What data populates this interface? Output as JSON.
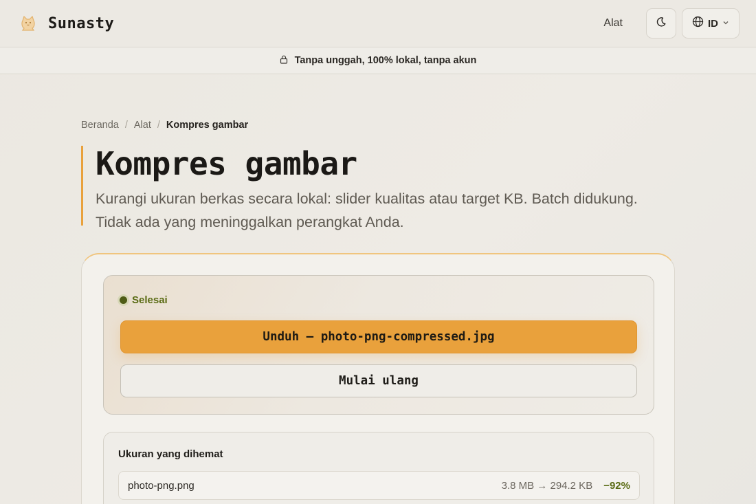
{
  "header": {
    "brand": "Sunasty",
    "nav_tools": "Alat",
    "language": "ID",
    "icons": {
      "logo": "cat-logo-icon",
      "theme": "moon-icon",
      "language": "globe-icon",
      "dropdown": "chevron-down-icon"
    }
  },
  "banner": {
    "text": "Tanpa unggah, 100% lokal, tanpa akun",
    "icon": "lock-icon"
  },
  "breadcrumb": {
    "home": "Beranda",
    "tools": "Alat",
    "current": "Kompres gambar",
    "separator": "/"
  },
  "page": {
    "title": "Kompres gambar",
    "subtitle": "Kurangi ukuran berkas secara lokal: slider kualitas atau target KB. Batch didukung. Tidak ada yang meninggalkan perangkat Anda."
  },
  "result": {
    "status": "Selesai",
    "download_label": "Unduh — photo-png-compressed.jpg",
    "restart_label": "Mulai ulang"
  },
  "savings": {
    "title": "Ukuran yang dihemat",
    "files": [
      {
        "name": "photo-png.png",
        "size_change": "3.8 MB → 294.2 KB",
        "percent": "−92%"
      }
    ]
  },
  "colors": {
    "accent": "#e9a13c",
    "success": "#5a6b14",
    "background": "#ebe8e1"
  }
}
